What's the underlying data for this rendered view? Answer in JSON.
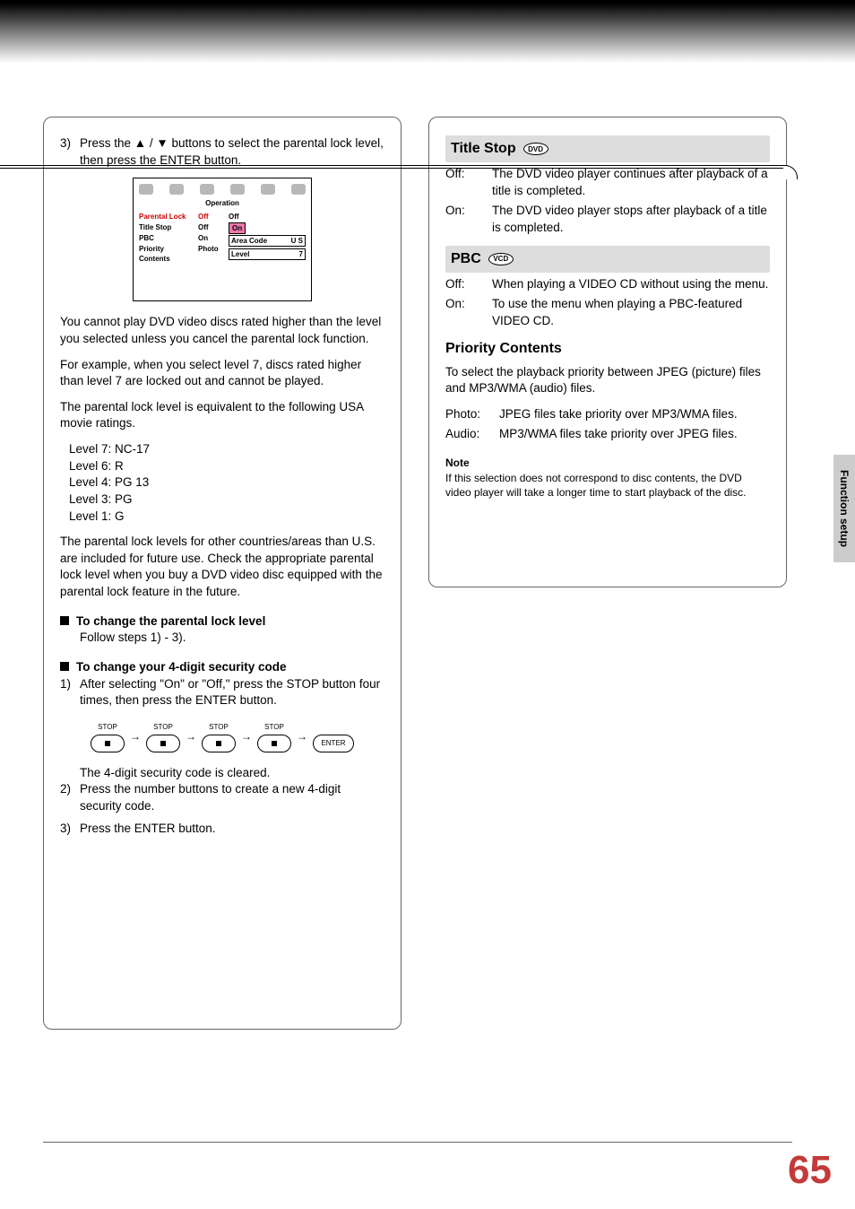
{
  "page_number": "65",
  "side_tab": "Function setup",
  "left": {
    "step3_num": "3)",
    "step3_text": "Press the ▲ / ▼ buttons to select the parental lock level, then press the ENTER button.",
    "osd": {
      "title": "Operation",
      "items": [
        {
          "label": "Parental Lock",
          "value": "Off"
        },
        {
          "label": "Title Stop",
          "value": "Off"
        },
        {
          "label": "PBC",
          "value": "On"
        },
        {
          "label": "Priority Contents",
          "value": "Photo"
        }
      ],
      "sub_off": "Off",
      "sub_on": "On",
      "area_code_label": "Area Code",
      "area_code_value": "U S",
      "level_label": "Level",
      "level_value": "7"
    },
    "para1": "You cannot play DVD video discs rated higher than the level you selected unless you cancel the parental lock function.",
    "para2": "For example, when you select level 7, discs rated higher than level 7 are locked out and cannot be played.",
    "para3": "The parental lock level is equivalent to the following USA movie ratings.",
    "ratings": [
      "Level 7: NC-17",
      "Level 6: R",
      "Level 4: PG 13",
      "Level 3: PG",
      "Level 1: G"
    ],
    "para4": "The parental lock levels for other countries/areas than U.S. are included for future use. Check the appropriate parental lock level when you buy a DVD video disc equipped with the parental lock feature in the future.",
    "bh1": "To change the parental lock level",
    "bh1_follow": "Follow steps 1) - 3).",
    "bh2": "To change your 4-digit security code",
    "s1_num": "1)",
    "s1_t": "After selecting \"On\" or \"Off,\" press the STOP button four times, then press the ENTER button.",
    "seq_stop": "STOP",
    "seq_enter": "ENTER",
    "s_cleared": "The 4-digit security code is cleared.",
    "s2_num": "2)",
    "s2_t": "Press the number buttons to create a new 4-digit security code.",
    "s3_num": "3)",
    "s3_t": "Press the ENTER button."
  },
  "right": {
    "title_stop": "Title Stop",
    "dvd_badge": "DVD",
    "ts_off_l": "Off:",
    "ts_off_v": "The DVD video player continues after playback of a title is completed.",
    "ts_on_l": "On:",
    "ts_on_v": "The DVD video player stops after playback of a title is completed.",
    "pbc": "PBC",
    "vcd_badge": "VCD",
    "pbc_off_l": "Off:",
    "pbc_off_v": "When playing a VIDEO CD without using the menu.",
    "pbc_on_l": "On:",
    "pbc_on_v": "To use the menu when playing a PBC-featured VIDEO CD.",
    "pc": "Priority Contents",
    "pc_desc": "To select the playback priority between JPEG (picture) files and MP3/WMA (audio) files.",
    "pc_photo_l": "Photo:",
    "pc_photo_v": "JPEG files take priority over MP3/WMA files.",
    "pc_audio_l": "Audio:",
    "pc_audio_v": "MP3/WMA files take priority over JPEG files.",
    "note_h": "Note",
    "note_t": "If this selection does not correspond to disc contents, the DVD video player will take a longer time to start playback of the disc."
  }
}
